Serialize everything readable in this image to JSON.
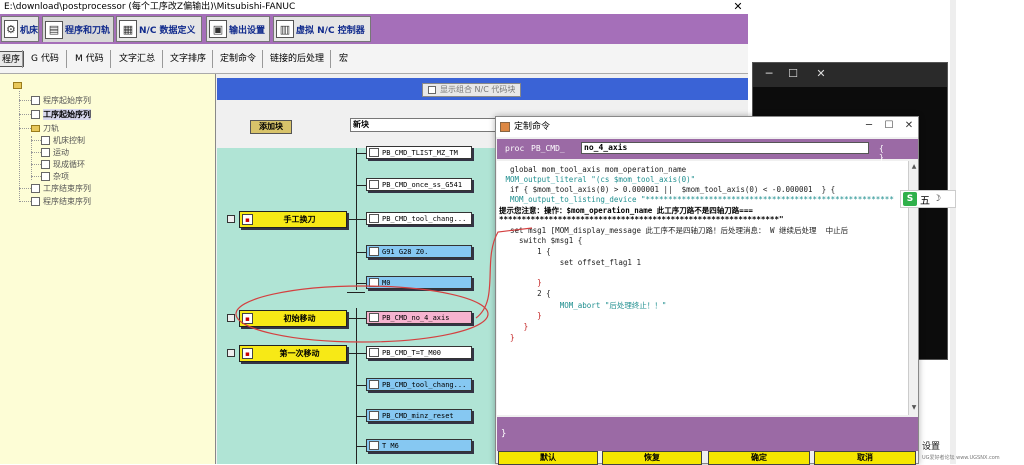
{
  "window": {
    "title": "E:\\download\\postprocessor (每个工序改Z偏输出)\\Mitsubishi-FANUC",
    "close_glyph": "✕"
  },
  "tabs": [
    {
      "label": "机床",
      "icon": "machine-icon"
    },
    {
      "label": "程序和刀轨",
      "icon": "program-toolpath-icon"
    },
    {
      "label": "N/C 数据定义",
      "icon": "nc-data-icon"
    },
    {
      "label": "输出设置",
      "icon": "output-settings-icon"
    },
    {
      "label": "虚拟 N/C 控制器",
      "icon": "virtual-controller-icon"
    }
  ],
  "subtabs": [
    "程序",
    "G 代码",
    "M 代码",
    "文字汇总",
    "文字排序",
    "定制命令",
    "链接的后处理",
    "宏"
  ],
  "tree": {
    "items": [
      {
        "label": "程序起始序列"
      },
      {
        "label": "工序起始序列"
      },
      {
        "label": "刀轨"
      },
      {
        "label": "机床控制"
      },
      {
        "label": "运动"
      },
      {
        "label": "现成循环"
      },
      {
        "label": "杂项"
      },
      {
        "label": "工序结束序列"
      },
      {
        "label": "程序结束序列"
      }
    ]
  },
  "content": {
    "show_combined": "显示组合 N/C 代码块",
    "add_block": "添加块",
    "block_field": "新块"
  },
  "events": [
    {
      "label": "手工换刀"
    },
    {
      "label": "初始移动"
    },
    {
      "label": "第一次移动"
    }
  ],
  "commands": [
    {
      "label": "PB_CMD_TLIST_MZ_TM"
    },
    {
      "label": "PB_CMD_once_ss_G541"
    },
    {
      "label": "PB_CMD_tool_chang..."
    },
    {
      "label": "G91 G28 Z0."
    },
    {
      "label": "M0"
    },
    {
      "label": "PB_CMD_no_4_axis"
    },
    {
      "label": "PB_CMD_T=T_M00"
    },
    {
      "label": "PB_CMD_tool_chang..."
    },
    {
      "label": "PB_CMD_minz_reset"
    },
    {
      "label": "T M6"
    }
  ],
  "dialog": {
    "title": "定制命令",
    "proc": "proc",
    "cmd_prefix": "PB_CMD_",
    "cmd_name": "no_4_axis",
    "braces": "{ }",
    "close_brace": "}",
    "buttons": [
      "默认",
      "恢复",
      "确定",
      "取消"
    ],
    "code": [
      "  global mom_tool_axis mom_operation_name",
      " MOM_output_literal \"(cs $mom_tool_axis(0)\"",
      "  if { $mom_tool_axis(0) > 0.000001 ||  $mom_tool_axis(0) < -0.000001  } {",
      "  MOM_output_to_listing_device \"*******************************************************",
      "提示您注意：操作：$mom_operation_name 此工序刀路不是四轴刀路===",
      "**************************************************************\"",
      "  set msg1 [MOM_display_message 此工序不是四轴刀路！后处理消息： W 继续后处理  中止后",
      "    switch $msg1 {",
      "        1 {",
      "             set offset_flag1 1",
      "",
      "        }",
      "        2 {",
      "             MOM_abort \"后处理终止！！\"",
      "        }",
      "     }",
      "  }"
    ]
  },
  "taskbar": {
    "ime_logo": "S",
    "ime_char": "五",
    "ime_moon": "☽",
    "settings": "设置",
    "watermark": "UG爱好者论坛 www.UGSNX.com"
  },
  "colors": {
    "tab_bar": "#a56fb9",
    "canvas": "#b0e4d5",
    "event": "#f7e916",
    "cmd_blue": "#86c8f2",
    "cmd_pink": "#f6b3cf",
    "proc_bar": "#9b6aa5",
    "blue_bar": "#3a63d6",
    "annotation": "#d44040"
  }
}
